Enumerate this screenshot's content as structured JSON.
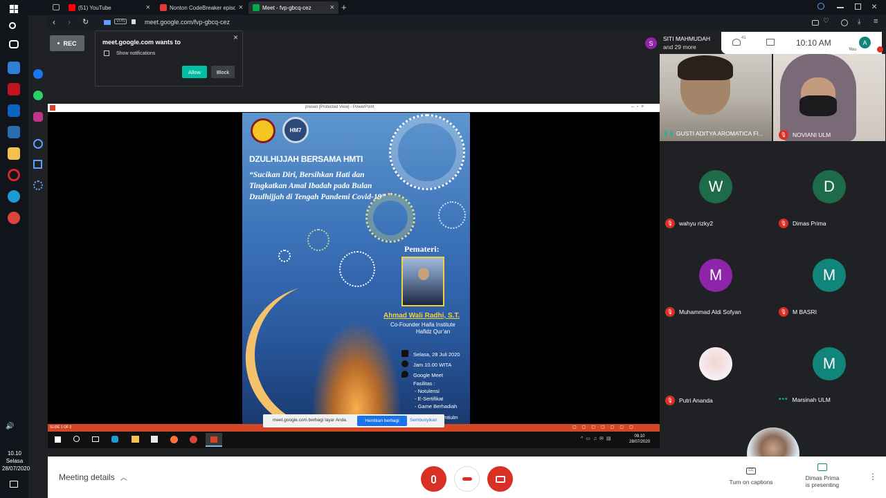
{
  "browser": {
    "tabs": [
      {
        "title": "(51) YouTube",
        "icon": "youtube-icon"
      },
      {
        "title": "Nonton CodeBreaker episod",
        "icon": "site-icon"
      },
      {
        "title": "Meet - fvp-gbcq-cez",
        "icon": "meet-icon"
      }
    ],
    "url": "meet.google.com/fvp-gbcq-cez",
    "vpn": "VPN"
  },
  "taskbar": {
    "time": "10.10",
    "day": "Selasa",
    "date": "28/07/2020"
  },
  "rec_label": "REC",
  "notification": {
    "title": "meet.google.com wants to",
    "item": "Show notifications",
    "allow": "Allow",
    "block": "Block"
  },
  "presenter_header": {
    "avatar_letter": "S",
    "name": "SITI MAHMUDAH",
    "more": "and 29 more",
    "people_count": "41",
    "clock": "10:10  AM",
    "you_letter": "A",
    "you_label": "You"
  },
  "ppt": {
    "title": "presen [Protected View] - PowerPoint",
    "status_left": "SLIDE 1 OF 2",
    "share_notice": "meet.google.com berbagi layar Anda.",
    "stop_share": "Hentikan berbagi",
    "hide": "Sembunyikan",
    "inner_time": "09.10",
    "inner_date": "28/07/2020"
  },
  "poster": {
    "title": "DZULHIJJAH BERSAMA HMTI",
    "quote": "“Sucikan Diri, Bersihkan Hati dan Tingkatkan Amal Ibadah pada Bulan Dzulhijjah di Tengah Pandemi Covid-19”",
    "logo2": "HM7",
    "speaker_label": "Pemateri:",
    "speaker_name": "Ahmad Wali Radhi, S.T.",
    "speaker_role1": "Co-Founder Haifa Institute",
    "speaker_role2": "Hafidz Qur’an",
    "date": "Selasa, 28 Juli 2020",
    "time": "Jam 10.00 WITA",
    "platform": "Google Meet",
    "facilities": "Fasilitas :",
    "fac1": "- Notulensi",
    "fac2": "- E-Sertifikat",
    "fac3": "- Game Berhadiah",
    "footer": "@hmtiulm"
  },
  "participants": [
    {
      "name": "GUSTI ADITYA AROMATICA FI...",
      "type": "video"
    },
    {
      "name": "NOVIANI ULM",
      "type": "video"
    },
    {
      "name": "wahyu rizky2",
      "letter": "W",
      "color": "#1e6b4a"
    },
    {
      "name": "Dimas Prima",
      "letter": "D",
      "color": "#1e6b4a"
    },
    {
      "name": "Muhammad Aldi Sofyan",
      "letter": "M",
      "color": "#8e24aa"
    },
    {
      "name": "M BASRI",
      "letter": "M",
      "color": "#12857a"
    },
    {
      "name": "Putri Ananda",
      "type": "photo"
    },
    {
      "name": "Marsinah ULM",
      "letter": "M",
      "color": "#12857a"
    }
  ],
  "bottom": {
    "meeting_details": "Meeting details",
    "captions": "Turn on captions",
    "presenting_line1": "Dimas Prima",
    "presenting_line2": "is presenting",
    "cc": "CC"
  },
  "colors": {
    "accent_teal": "#00bfa5",
    "danger": "#d93025",
    "ppt_orange": "#d24726"
  }
}
